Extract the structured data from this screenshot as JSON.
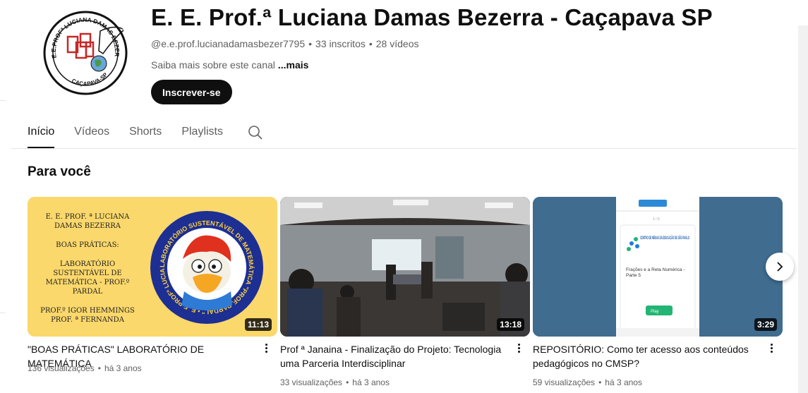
{
  "channel": {
    "title": "E. E. Prof.ª Luciana Damas Bezerra - Caçapava SP",
    "handle": "@e.e.prof.lucianadamasbezer7795",
    "subscribers": "33 inscritos",
    "videos_count": "28 vídeos",
    "separator": "•",
    "about": "Saiba mais sobre este canal",
    "about_more": "...mais",
    "subscribe_label": "Inscrever-se",
    "logo_text_top": "E.E.PROFª LUCIANA DAMAS BEZERRA",
    "logo_text_bottom": "CAÇAPAVA-SP"
  },
  "tabs": [
    {
      "label": "Início",
      "active": true
    },
    {
      "label": "Vídeos",
      "active": false
    },
    {
      "label": "Shorts",
      "active": false
    },
    {
      "label": "Playlists",
      "active": false
    }
  ],
  "section": {
    "title": "Para você"
  },
  "videos": [
    {
      "title": "\"BOAS PRÁTICAS\" LABORATÓRIO DE MATEMÁTICA",
      "views": "136 visualizações",
      "age": "há 3 anos",
      "duration": "11:13",
      "thumb_lines": [
        "E. E. PROF. ª LUCIANA DAMAS BEZERRA",
        "BOAS PRÁTICAS:",
        "LABORATÓRIO SUSTENTÁVEL DE MATEMÁTICA - PROF.º PARDAL",
        "PROF.º IGOR HEMMINGS PROF. ª FERNANDA"
      ],
      "thumb_badge_text": "LABORATÓRIO SUSTENTÁVEL DE MATEMÁTICA \"PROF. PARDAL\" • E. E PROFª LUCIANA DAMAS BEZERRA"
    },
    {
      "title": "Prof ª Janaina - Finalização do Projeto: Tecnologia uma Parceria Interdisciplinar",
      "views": "33 visualizações",
      "age": "há 3 anos",
      "duration": "13:18"
    },
    {
      "title": "REPOSITÓRIO: Como ter acesso aos conteúdos pedagógicos no CMSP?",
      "views": "59 visualizações",
      "age": "há 3 anos",
      "duration": "3:29",
      "thumb_card_brand": "CENTRO DE MÍDIAS DA EDUCAÇÃO DE SÃO PAULO",
      "thumb_card_title": "Frações e a Reta Numérica - Parte 5",
      "thumb_card_button": "Play"
    }
  ],
  "colors": {
    "accent": "#0f0f0f",
    "muted": "#606060",
    "thumb1_bg": "#fbd86b",
    "thumb3_bg": "#3f6c8f"
  },
  "icons": [
    "search-icon",
    "more-vert-icon",
    "chevron-right-icon"
  ]
}
